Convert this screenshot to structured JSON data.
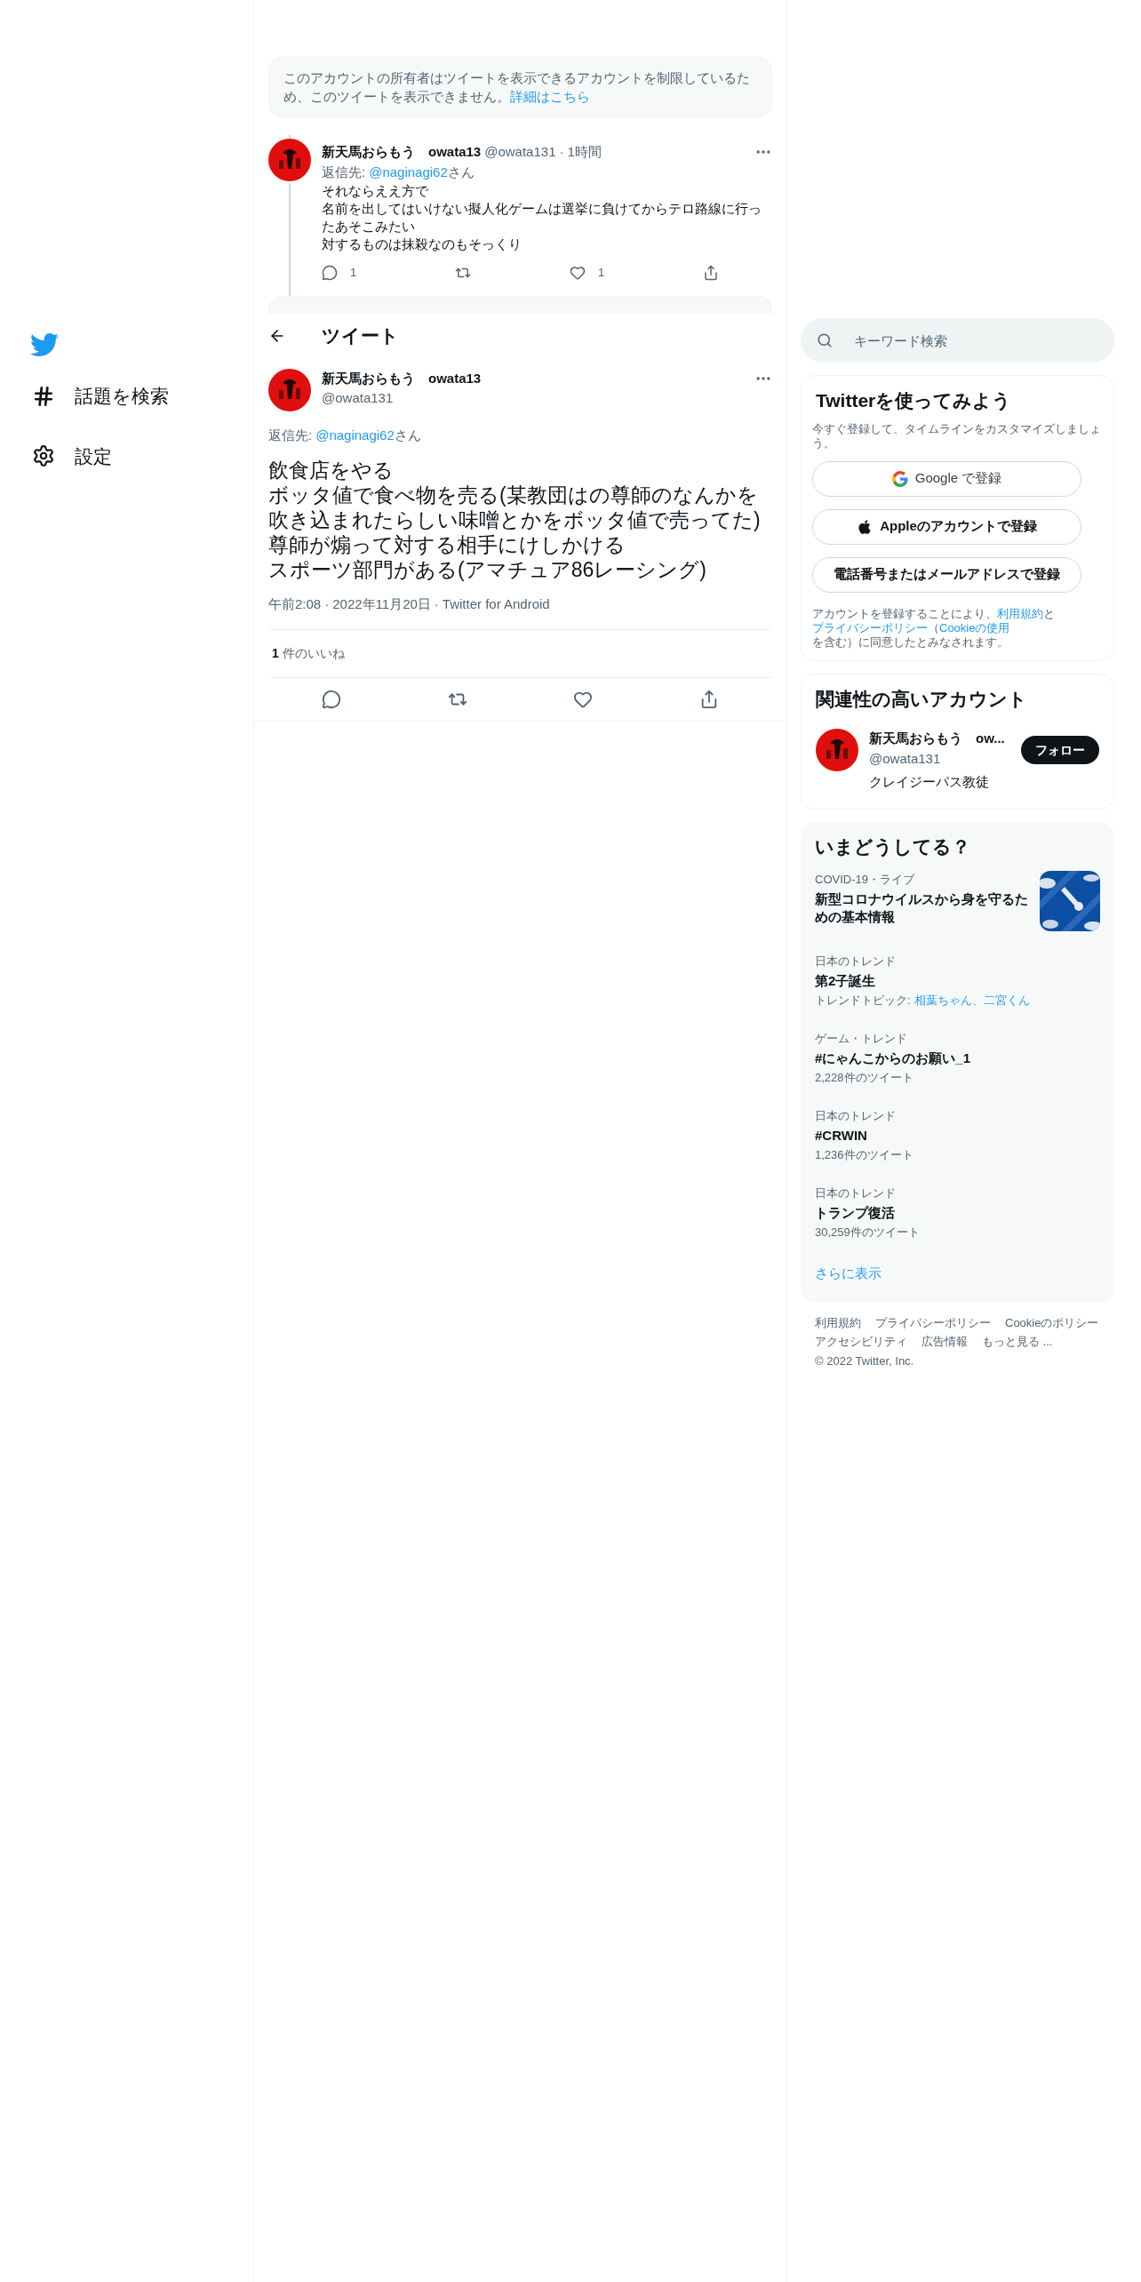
{
  "sidebar": {
    "items": [
      {
        "kind": "hashtag",
        "label": "話題を検索"
      },
      {
        "kind": "settings",
        "label": "設定"
      }
    ]
  },
  "timeline": {
    "notice": {
      "text": "このアカウントの所有者はツイートを表示できるアカウントを制限しているため、このツイートを表示できません。",
      "link": "詳細はこちら"
    },
    "reply_tweet": {
      "name": "新天馬おらもう　owata13",
      "handle": "@owata131",
      "time": "1時間",
      "reply_label": "返信先:",
      "reply_to": "@naginagi62",
      "reply_suffix": "さん",
      "lines": [
        "それならええ方で",
        "名前を出してはいけない擬人化ゲームは選挙に負けてからテロ路線に行ったあそこみたい",
        "対するものは抹殺なのもそっくり"
      ],
      "separator": "·",
      "reply_count": "1",
      "like_count": "1"
    }
  },
  "header": {
    "title": "ツイート"
  },
  "main_tweet": {
    "name": "新天馬おらもう　owata13",
    "handle": "@owata131",
    "reply_label": "返信先:",
    "reply_to": "@naginagi62",
    "reply_suffix": "さん",
    "lines": [
      "飲食店をやる",
      "ボッタ値で食べ物を売る(某教団はの尊師のなんかを吹き込まれたらしい味噌とかをボッタ値で売ってた)",
      "尊師が煽って対する相手にけしかける",
      "スポーツ部門がある(アマチュア86レーシング)"
    ],
    "separators": [
      "·",
      "·"
    ],
    "time": "午前2:08",
    "date": "2022年11月20日",
    "source": "Twitter for Android",
    "like_count": "1",
    "like_label": "件のいいね"
  },
  "search": {
    "placeholder": "キーワード検索"
  },
  "signup": {
    "title": "Twitterを使ってみよう",
    "subtitle": "今すぐ登録して、タイムラインをカスタマイズしましょう。",
    "buttons": [
      {
        "kind": "google",
        "label": "Google で登録"
      },
      {
        "kind": "apple",
        "label": "Appleのアカウントで登録"
      },
      {
        "kind": "plain",
        "label": "電話番号またはメールアドレスで登録"
      }
    ],
    "legal": [
      {
        "text": "アカウントを登録することにより、",
        "link": false
      },
      {
        "text": "利用規約",
        "link": true
      },
      {
        "text": "と",
        "link": false
      },
      {
        "text": "プライバシーポリシー",
        "link": true
      },
      {
        "text": "（",
        "link": false
      },
      {
        "text": "Cookieの使用",
        "link": true
      },
      {
        "text": "を含む）に同意した",
        "link": false
      },
      {
        "text": "とみなされます。",
        "link": false
      }
    ]
  },
  "related": {
    "title": "関連性の高いアカウント",
    "name": "新天馬おらもう　ow...",
    "handle": "@owata131",
    "bio": "クレイジーパス教徒",
    "follow": "フォロー"
  },
  "trends": {
    "title": "いまどうしてる？",
    "items": [
      {
        "kind": "news",
        "category": "COVID-19・ライブ",
        "title": "新型コロナウイルスから身を守るための基本情報"
      },
      {
        "kind": "topics",
        "category": "日本のトレンド",
        "title": "第2子誕生",
        "label": "トレンドトピック:",
        "topics": "相葉ちゃん、二宮くん"
      },
      {
        "kind": "count",
        "category": "ゲーム・トレンド",
        "title": "#にゃんこからのお願い_1",
        "count": "2,228件のツイート"
      },
      {
        "kind": "count",
        "category": "日本のトレンド",
        "title": "#CRWIN",
        "count": "1,236件のツイート"
      },
      {
        "kind": "count",
        "category": "日本のトレンド",
        "title": "トランプ復活",
        "count": "30,259件のツイート"
      }
    ],
    "more": "さらに表示"
  },
  "footer": {
    "links": [
      "利用規約",
      "プライバシーポリシー",
      "Cookieのポリシー",
      "アクセシビリティ",
      "広告情報",
      "もっと見る ..."
    ],
    "copyright": "© 2022 Twitter, Inc."
  }
}
